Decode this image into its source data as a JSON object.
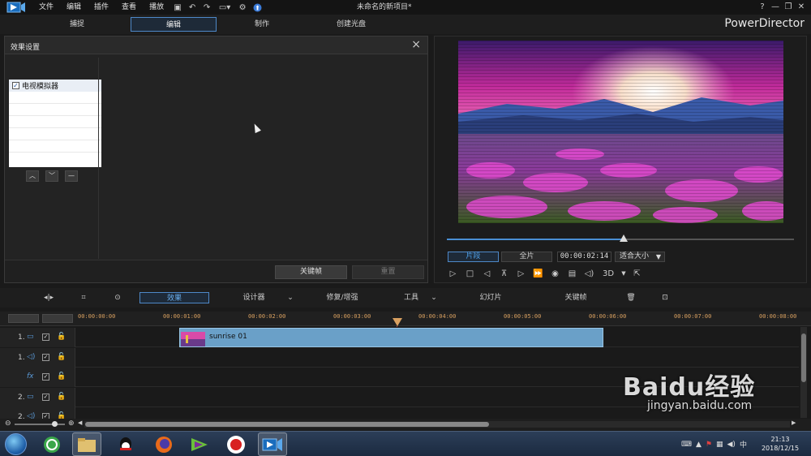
{
  "menubar": {
    "items": [
      "文件",
      "编辑",
      "插件",
      "查看",
      "播放"
    ],
    "project_title": "未命名的新项目*",
    "window_controls": [
      "?",
      "—",
      "❐",
      "✕"
    ]
  },
  "modes": {
    "tabs": [
      "捕捉",
      "编辑",
      "制作",
      "创建光盘"
    ],
    "active": "编辑",
    "brand": "PowerDirector"
  },
  "effect_panel": {
    "title": "效果设置",
    "effect_item": "电视模拟器",
    "effect_checked": true,
    "keyframe_button": "关键帧",
    "reset_button": "重置"
  },
  "preview": {
    "clip_tab": "片段",
    "full_tab": "全片",
    "timecode": "00:00:02:14",
    "fit_option": "适合大小",
    "mode_3d": "3D",
    "progress": 0.51
  },
  "timeline_toolbar": {
    "effect_button": "效果",
    "designer": "设计器",
    "fix_enhance": "修复/增强",
    "tools": "工具",
    "slideshow": "幻灯片",
    "keyframe": "关键帧"
  },
  "ruler": {
    "labels": [
      "00:00:00:00",
      "00:00:01:00",
      "00:00:02:00",
      "00:00:03:00",
      "00:00:04:00",
      "00:00:05:00",
      "00:00:06:00",
      "00:00:07:00",
      "00:00:08:00"
    ]
  },
  "tracks": {
    "rows": [
      {
        "num": "1.",
        "icon": "video-track-icon"
      },
      {
        "num": "1.",
        "icon": "audio-track-icon"
      },
      {
        "num": "",
        "icon": "fx-track-icon",
        "label": "fx"
      },
      {
        "num": "2.",
        "icon": "video-track-icon"
      },
      {
        "num": "2.",
        "icon": "audio-track-icon"
      }
    ],
    "clip_name": "sunrise 01"
  },
  "taskbar": {
    "time": "21:13",
    "date": "2018/12/15"
  },
  "watermark": {
    "text": "Baidu经验",
    "url": "jingyan.baidu.com"
  },
  "colors": {
    "accent": "#4e88c8",
    "clip": "#6aa0c8",
    "playhead": "#c0392b",
    "ruler_text": "#d8a060"
  }
}
